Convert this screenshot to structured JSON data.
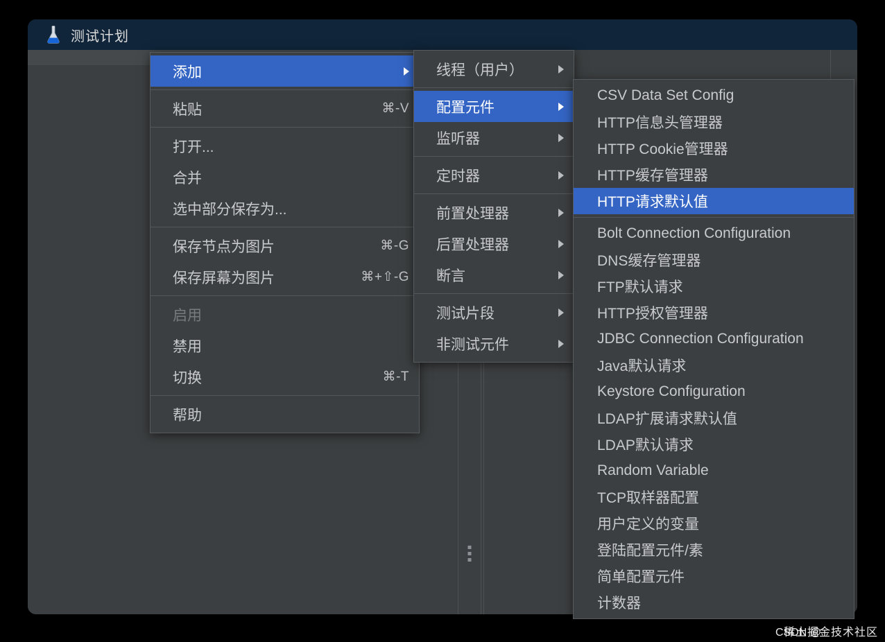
{
  "window": {
    "title": "测试计划",
    "icon": "jmeter-flask-icon",
    "title_bar_color": "#10253a",
    "body_color": "#3c3f41"
  },
  "colors": {
    "accent_selected": "#3465c4",
    "menu_background": "#3c3f41",
    "menu_border": "#585b5d",
    "text": "#c8cace",
    "text_disabled": "#787b7e",
    "separator": "#555859"
  },
  "context_menu": {
    "name": "tree-node-context-menu",
    "groups": [
      [
        {
          "label": "添加",
          "accel": "",
          "submenu": true,
          "selected": true,
          "disabled": false
        }
      ],
      [
        {
          "label": "粘贴",
          "accel": "⌘-V",
          "submenu": false,
          "selected": false,
          "disabled": false
        }
      ],
      [
        {
          "label": "打开...",
          "accel": "",
          "submenu": false,
          "selected": false,
          "disabled": false
        },
        {
          "label": "合并",
          "accel": "",
          "submenu": false,
          "selected": false,
          "disabled": false
        },
        {
          "label": "选中部分保存为...",
          "accel": "",
          "submenu": false,
          "selected": false,
          "disabled": false
        }
      ],
      [
        {
          "label": "保存节点为图片",
          "accel": "⌘-G",
          "submenu": false,
          "selected": false,
          "disabled": false
        },
        {
          "label": "保存屏幕为图片",
          "accel": "⌘+⇧-G",
          "submenu": false,
          "selected": false,
          "disabled": false
        }
      ],
      [
        {
          "label": "启用",
          "accel": "",
          "submenu": false,
          "selected": false,
          "disabled": true
        },
        {
          "label": "禁用",
          "accel": "",
          "submenu": false,
          "selected": false,
          "disabled": false
        },
        {
          "label": "切换",
          "accel": "⌘-T",
          "submenu": false,
          "selected": false,
          "disabled": false
        }
      ],
      [
        {
          "label": "帮助",
          "accel": "",
          "submenu": false,
          "selected": false,
          "disabled": false
        }
      ]
    ]
  },
  "add_submenu": {
    "name": "add-submenu",
    "groups": [
      [
        {
          "label": "线程（用户）",
          "submenu": true,
          "selected": false
        }
      ],
      [
        {
          "label": "配置元件",
          "submenu": true,
          "selected": true
        },
        {
          "label": "监听器",
          "submenu": true,
          "selected": false
        }
      ],
      [
        {
          "label": "定时器",
          "submenu": true,
          "selected": false
        }
      ],
      [
        {
          "label": "前置处理器",
          "submenu": true,
          "selected": false
        },
        {
          "label": "后置处理器",
          "submenu": true,
          "selected": false
        },
        {
          "label": "断言",
          "submenu": true,
          "selected": false
        }
      ],
      [
        {
          "label": "测试片段",
          "submenu": true,
          "selected": false
        },
        {
          "label": "非测试元件",
          "submenu": true,
          "selected": false
        }
      ]
    ]
  },
  "config_submenu": {
    "name": "config-element-submenu",
    "groups": [
      [
        {
          "label": "CSV Data Set Config",
          "selected": false
        },
        {
          "label": "HTTP信息头管理器",
          "selected": false
        },
        {
          "label": "HTTP Cookie管理器",
          "selected": false
        },
        {
          "label": "HTTP缓存管理器",
          "selected": false
        },
        {
          "label": "HTTP请求默认值",
          "selected": true
        }
      ],
      [
        {
          "label": "Bolt Connection Configuration",
          "selected": false
        },
        {
          "label": "DNS缓存管理器",
          "selected": false
        },
        {
          "label": "FTP默认请求",
          "selected": false
        },
        {
          "label": "HTTP授权管理器",
          "selected": false
        },
        {
          "label": "JDBC Connection Configuration",
          "selected": false
        },
        {
          "label": "Java默认请求",
          "selected": false
        },
        {
          "label": "Keystore Configuration",
          "selected": false
        },
        {
          "label": "LDAP扩展请求默认值",
          "selected": false
        },
        {
          "label": "LDAP默认请求",
          "selected": false
        },
        {
          "label": "Random Variable",
          "selected": false
        },
        {
          "label": "TCP取样器配置",
          "selected": false
        },
        {
          "label": "用户定义的变量",
          "selected": false
        },
        {
          "label": "登陆配置元件/素",
          "selected": false
        },
        {
          "label": "简单配置元件",
          "selected": false
        },
        {
          "label": "计数器",
          "selected": false
        }
      ]
    ]
  },
  "watermarks": {
    "csdn": "CSDN @",
    "juejin": "稀土掘金技术社区"
  }
}
